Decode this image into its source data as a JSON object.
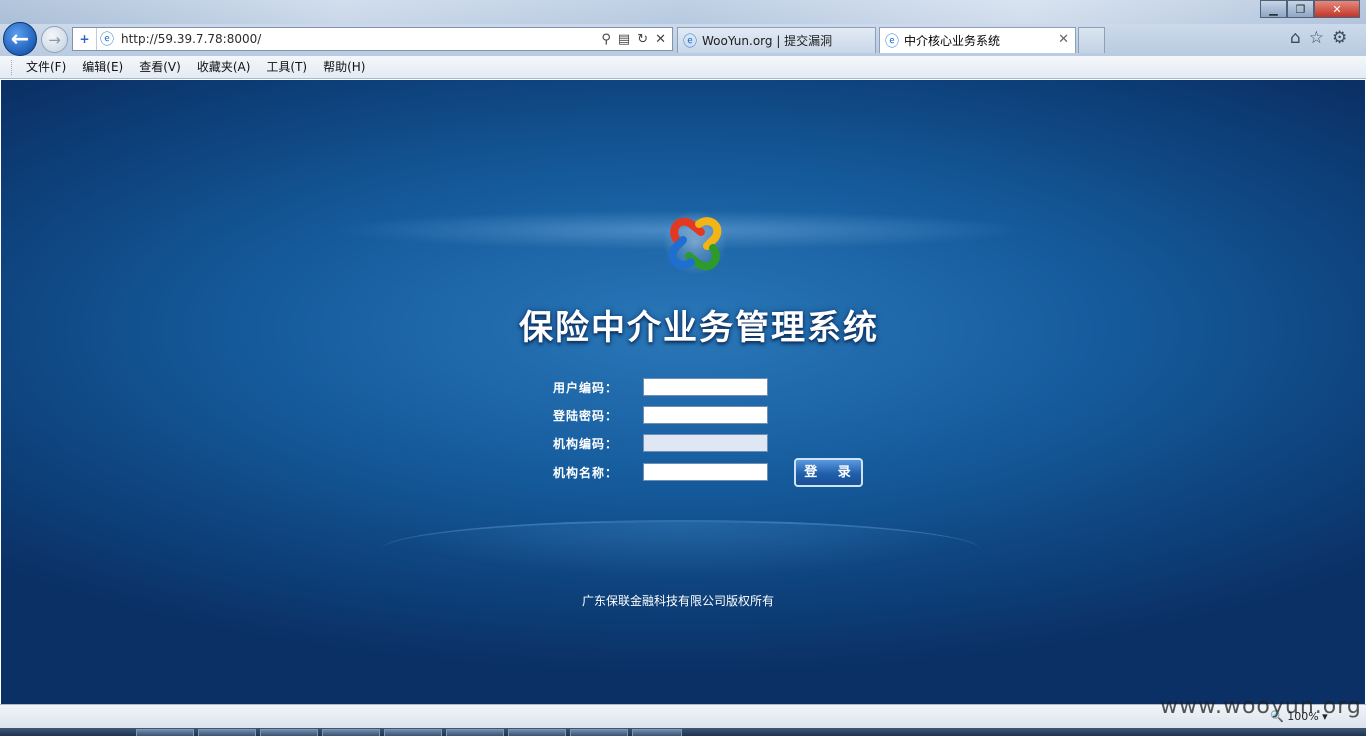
{
  "browser": {
    "address_url": "http://59.39.7.78:8000/",
    "tabs": [
      {
        "label": "WooYun.org | 提交漏洞"
      },
      {
        "label": "中介核心业务系统"
      }
    ],
    "menu": [
      "文件(F)",
      "编辑(E)",
      "查看(V)",
      "收藏夹(A)",
      "工具(T)",
      "帮助(H)"
    ],
    "zoom": "100%"
  },
  "login": {
    "system_title": "保险中介业务管理系统",
    "fields": [
      {
        "label": "用户编码：",
        "value": ""
      },
      {
        "label": "登陆密码：",
        "value": ""
      },
      {
        "label": "机构编码：",
        "value": ""
      },
      {
        "label": "机构名称：",
        "value": ""
      }
    ],
    "submit_label": "登 录",
    "copyright": "广东保联金融科技有限公司版权所有"
  },
  "watermark": "www.wooyun.org",
  "icons": {
    "back": "back-arrow-icon",
    "forward": "forward-arrow-icon",
    "page": "ie-page-icon",
    "home": "home-icon",
    "favorites": "star-icon",
    "tools": "gear-icon"
  }
}
